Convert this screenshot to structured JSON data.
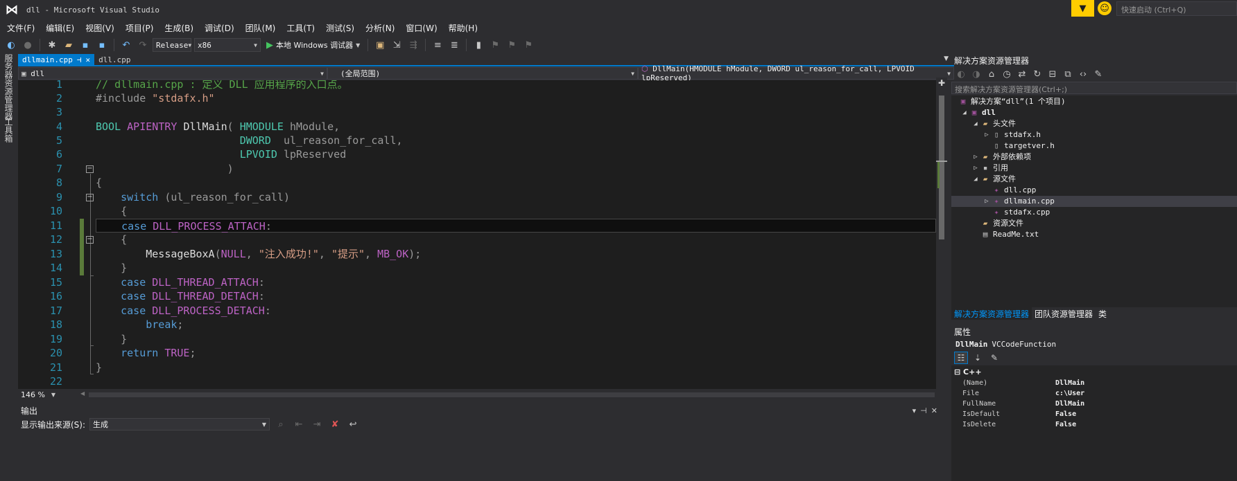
{
  "window": {
    "title": "dll - Microsoft Visual Studio",
    "logo_glyph": "⋈",
    "quick_launch_placeholder": "快速启动 (Ctrl+Q)"
  },
  "menu": [
    "文件(F)",
    "编辑(E)",
    "视图(V)",
    "项目(P)",
    "生成(B)",
    "调试(D)",
    "团队(M)",
    "工具(T)",
    "测试(S)",
    "分析(N)",
    "窗口(W)",
    "帮助(H)"
  ],
  "toolbar": {
    "configuration": "Release",
    "platform": "x86",
    "run_label": "本地 Windows 调试器"
  },
  "left_tabs": [
    "服务器资源管理器",
    "工具箱"
  ],
  "doc_tabs": [
    {
      "label": "dllmain.cpp",
      "active": true
    },
    {
      "label": "dll.cpp",
      "active": false
    }
  ],
  "nav": {
    "project": "dll",
    "scope": "(全局范围)",
    "member": "DllMain(HMODULE hModule, DWORD ul_reason_for_call, LPVOID lpReserved)"
  },
  "editor": {
    "line_numbers": [
      "1",
      "2",
      "3",
      "4",
      "5",
      "6",
      "7",
      "8",
      "9",
      "10",
      "11",
      "12",
      "13",
      "14",
      "15",
      "16",
      "17",
      "18",
      "19",
      "20",
      "21",
      "22"
    ],
    "current_line": 11,
    "zoom": "146 %"
  },
  "output": {
    "title": "输出",
    "source_label": "显示输出来源(S):",
    "source_value": "生成"
  },
  "solution_explorer": {
    "title": "解决方案资源管理器",
    "search_placeholder": "搜索解决方案资源管理器(Ctrl+;)",
    "tree": [
      {
        "label": "解决方案“dll”(1 个项目)",
        "type": "sln",
        "depth": 0,
        "exp": ""
      },
      {
        "label": "dll",
        "type": "proj",
        "depth": 1,
        "exp": "◢",
        "bold": true
      },
      {
        "label": "头文件",
        "type": "folder",
        "depth": 2,
        "exp": "◢"
      },
      {
        "label": "stdafx.h",
        "type": "h",
        "depth": 3,
        "exp": "▷"
      },
      {
        "label": "targetver.h",
        "type": "h",
        "depth": 3,
        "exp": ""
      },
      {
        "label": "外部依赖项",
        "type": "folder",
        "depth": 2,
        "exp": "▷"
      },
      {
        "label": "引用",
        "type": "ref",
        "depth": 2,
        "exp": "▷"
      },
      {
        "label": "源文件",
        "type": "folder",
        "depth": 2,
        "exp": "◢"
      },
      {
        "label": "dll.cpp",
        "type": "cpp",
        "depth": 3,
        "exp": ""
      },
      {
        "label": "dllmain.cpp",
        "type": "cpp",
        "depth": 3,
        "exp": "▷",
        "selected": true
      },
      {
        "label": "stdafx.cpp",
        "type": "cpp",
        "depth": 3,
        "exp": ""
      },
      {
        "label": "资源文件",
        "type": "folder",
        "depth": 2,
        "exp": ""
      },
      {
        "label": "ReadMe.txt",
        "type": "txt",
        "depth": 2,
        "exp": ""
      }
    ],
    "tabs": [
      "解决方案资源管理器",
      "团队资源管理器",
      "类"
    ]
  },
  "properties": {
    "title": "属性",
    "object_name": "DllMain",
    "object_type": "VCCodeFunction",
    "category": "C++",
    "rows": [
      {
        "name": "(Name)",
        "value": "DllMain"
      },
      {
        "name": "File",
        "value": "c:\\User"
      },
      {
        "name": "FullName",
        "value": "DllMain"
      },
      {
        "name": "IsDefault",
        "value": "False"
      },
      {
        "name": "IsDelete",
        "value": "False"
      }
    ]
  },
  "colors": {
    "accent": "#007acc",
    "keyword": "#569cd6",
    "macro": "#bd63c5",
    "type": "#4ec9b0",
    "string": "#d69d85",
    "comment": "#57a64a",
    "line_number": "#2b91af"
  }
}
